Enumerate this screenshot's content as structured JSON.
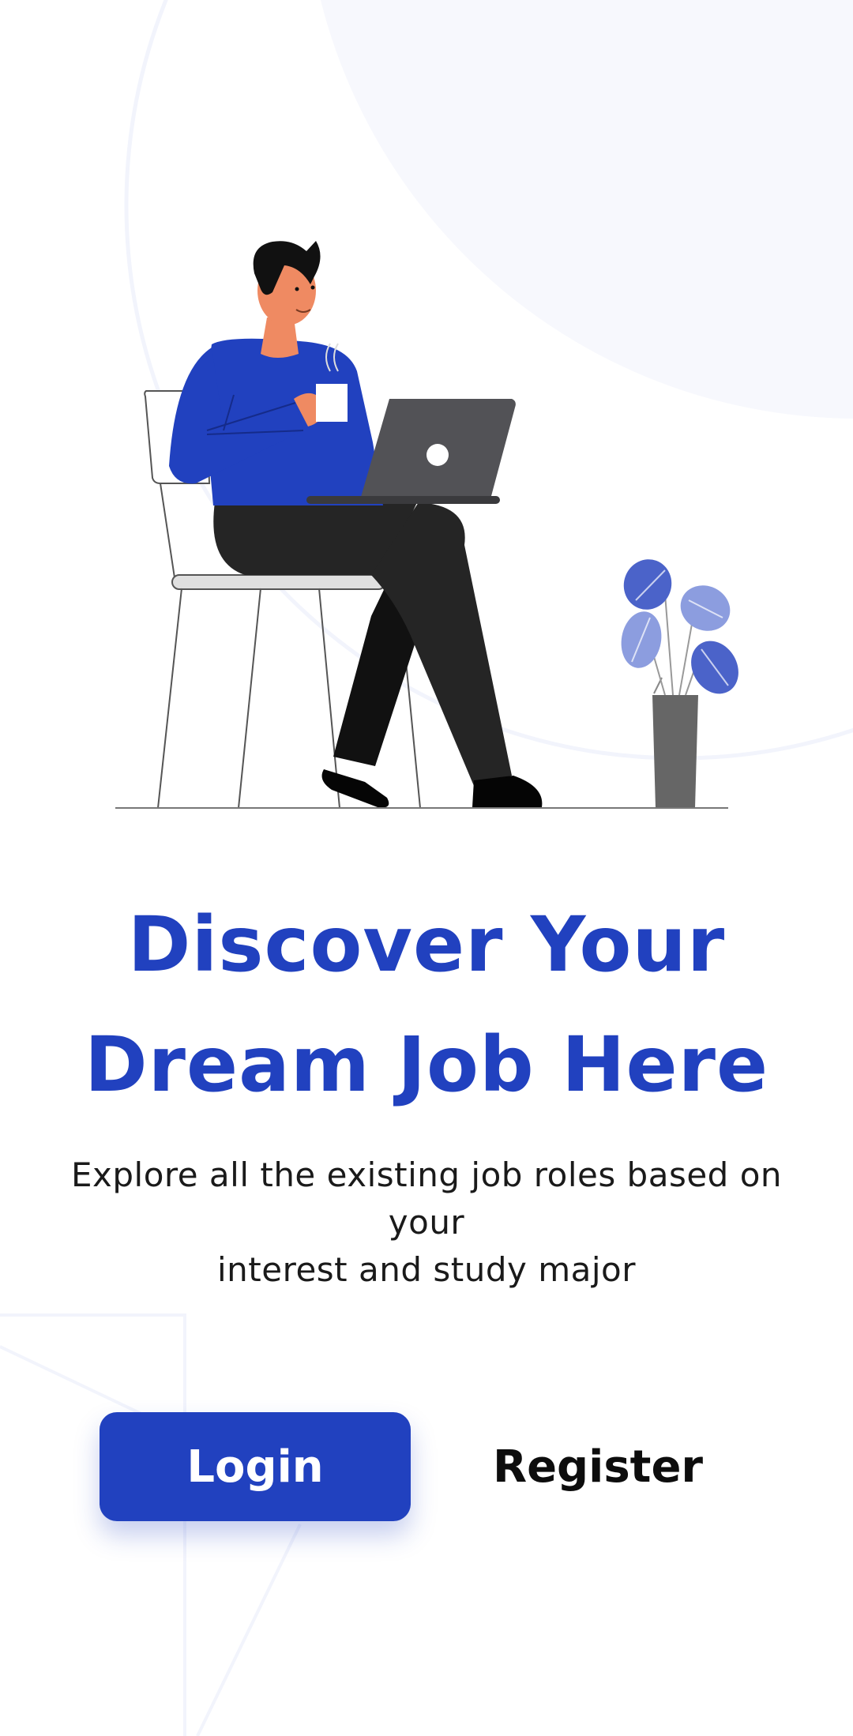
{
  "hero": {
    "title_line1": "Discover Your",
    "title_line2": "Dream Job Here",
    "subtitle_line1": "Explore all the existing job roles based on your",
    "subtitle_line2": "interest and study major"
  },
  "actions": {
    "login_label": "Login",
    "register_label": "Register"
  },
  "colors": {
    "brand": "#2141bf",
    "background": "#ffffff",
    "decor": "#f7f8fd"
  }
}
